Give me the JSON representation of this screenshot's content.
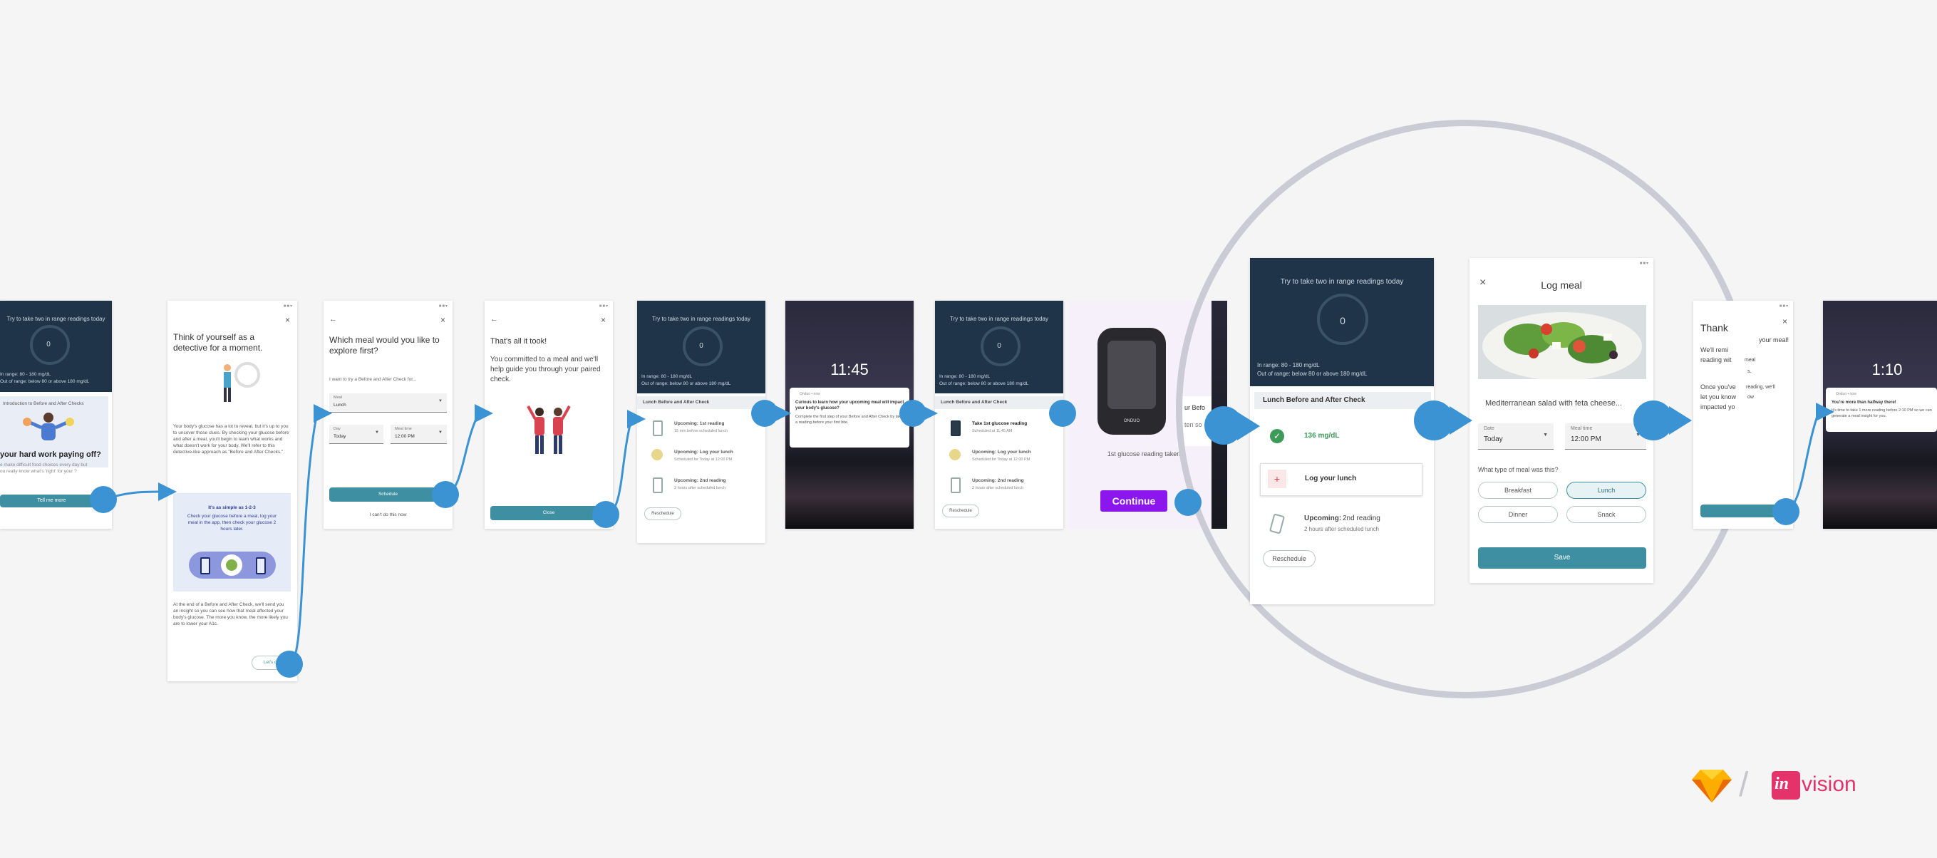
{
  "screens": {
    "s1": {
      "banner": "Try to take two in range readings today",
      "ring": "0",
      "range1": "In range: 80 - 180 mg/dL",
      "range2": "Out of range: below 80 or above 180 mg/dL",
      "card_title": "Introduction to Before and After Checks",
      "card_heading": "your hard work paying off?",
      "card_body": "e make difficult food choices every day but ou really know what's 'right' for your ?",
      "button": "Tell me more"
    },
    "s2": {
      "heading": "Think of yourself as a detective for a moment.",
      "body": "Your body's glucose has a lot to reveal, but it's up to you to uncover those clues. By checking your glucose before and after a meal, you'll begin to learn what works and what doesn't work for your body. We'll refer to this detective-like approach as \"Before and After Checks.\"",
      "box_title": "It's as simple as 1-2-3",
      "box_body": "Check your glucose before a meal, log your meal in the app, then check your glucose 2 hours later.",
      "footer": "At the end of a Before and After Check, we'll send you an insight so you can see how that meal affected your body's glucose. The more you know, the more likely you are to lower your A1c.",
      "button": "Let's do"
    },
    "s3": {
      "heading": "Which meal would you like to explore first?",
      "sub": "I want to try a Before and After Check for...",
      "meal_label": "Meal",
      "meal_value": "Lunch",
      "day_label": "Day",
      "day_value": "Today",
      "time_label": "Meal time",
      "time_value": "12:00 PM",
      "schedule": "Schedule",
      "later": "I can't do this now"
    },
    "s4": {
      "heading": "That's all it took!",
      "body": "You committed to a meal and we'll help guide you through your paired check.",
      "button": "Close"
    },
    "s5": {
      "banner": "Try to take two in range readings today",
      "ring": "0",
      "range1": "In range: 80 - 180 mg/dL",
      "range2": "Out of range: below 80 or above 180 mg/dL",
      "section": "Lunch Before and After Check",
      "items": [
        {
          "title": "Upcoming: 1st reading",
          "sub": "15 min before scheduled lunch"
        },
        {
          "title": "Upcoming: Log your lunch",
          "sub": "Scheduled for Today at 12:00 PM"
        },
        {
          "title": "Upcoming: 2nd reading",
          "sub": "2 hours after scheduled lunch"
        }
      ],
      "button": "Reschedule"
    },
    "s6": {
      "time": "11:45",
      "app": "Onduo • now",
      "notif_title": "Curious to learn how your upcoming meal will impact your body's glucose?",
      "notif_body": "Complete the first step of your Before and After Check by taking a reading before your first bite."
    },
    "s7": {
      "banner": "Try to take two in range readings today",
      "ring": "0",
      "range1": "In range: 80 - 180 mg/dL",
      "range2": "Out of range: below 80 or above 180 mg/dL",
      "section": "Lunch Before and After Check",
      "items": [
        {
          "title": "Take 1st glucose reading",
          "sub": "Scheduled at 11:45 AM"
        },
        {
          "title": "Upcoming: Log your lunch",
          "sub": "Scheduled for Today at 12:00 PM"
        },
        {
          "title": "Upcoming: 2nd reading",
          "sub": "2 hours after scheduled lunch"
        }
      ],
      "button": "Reschedule"
    },
    "s8": {
      "meter_brand": "ONDUO",
      "caption": "1st glucose reading taken",
      "button": "Continue",
      "peek1": "ur Befo",
      "peek2": "ten so"
    },
    "s9": {
      "banner": "Try to take two in range readings today",
      "ring": "0",
      "range1": "In range: 80 - 180 mg/dL",
      "range2": "Out of range: below 80 or above 180 mg/dL",
      "section": "Lunch Before and After Check",
      "reading": "136 mg/dL",
      "log": "Log your lunch",
      "upcoming": "Upcoming:",
      "upcoming_rest": "2nd reading",
      "upcoming_sub": "2 hours after scheduled lunch",
      "button": "Reschedule"
    },
    "s10": {
      "title": "Log meal",
      "meal": "Mediterranean salad with feta cheese...",
      "date_label": "Date",
      "date_value": "Today",
      "time_label": "Meal time",
      "time_value": "12:00 PM",
      "question": "What type of meal was this?",
      "options": [
        "Breakfast",
        "Lunch",
        "Dinner",
        "Snack"
      ],
      "save": "Save"
    },
    "s11": {
      "heading": "Thank",
      "line1": "your meal!",
      "line2": "We'll remi",
      "line3": "reading wit",
      "line4": "meal",
      "line5": "s.",
      "line6": "Once you've",
      "line7": "reading, we'll",
      "line8": "let you know",
      "line9": "ow",
      "line10": "impacted yo"
    },
    "s12": {
      "time": "1:10",
      "app": "Onduo • now",
      "notif_title": "You're more than halfway there!",
      "notif_body": "It's time to take 1 more reading before 2:10 PM so we can generate a meal insight for you."
    }
  },
  "brand": {
    "slash": "/",
    "invision_in": "in",
    "invision_rest": "vision"
  },
  "colors": {
    "teal": "#3f8fa3",
    "connector": "#3b93d3",
    "purple": "#8b16ee",
    "dark": "#1f3449",
    "invision": "#e3336a",
    "sketch": "#fdb300"
  }
}
